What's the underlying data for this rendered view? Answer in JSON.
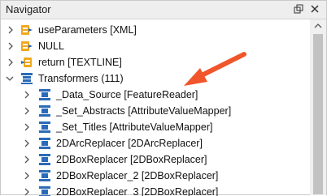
{
  "panel": {
    "title": "Navigator",
    "restore_icon": "restore-icon",
    "close_icon": "close-icon"
  },
  "tree": {
    "items": [
      {
        "label": "useParameters [XML]",
        "expanded": false,
        "icon": "writer-icon"
      },
      {
        "label": "NULL",
        "expanded": false,
        "icon": "writer-icon"
      },
      {
        "label": "return [TEXTLINE]",
        "expanded": false,
        "icon": "writer-return-icon"
      },
      {
        "label": "Transformers (111)",
        "expanded": true,
        "icon": "transformer-group-icon"
      }
    ],
    "children": [
      {
        "label": "_Data_Source [FeatureReader]"
      },
      {
        "label": "_Set_Abstracts [AttributeValueMapper]"
      },
      {
        "label": "_Set_Titles [AttributeValueMapper]"
      },
      {
        "label": "2DArcReplacer [2DArcReplacer]"
      },
      {
        "label": "2DBoxReplacer [2DBoxReplacer]"
      },
      {
        "label": "2DBoxReplacer_2 [2DBoxReplacer]"
      },
      {
        "label": "2DBoxReplacer_3 [2DBoxReplacer]"
      }
    ]
  },
  "colors": {
    "annotation_arrow": "#f0562a",
    "transformer_icon": "#2a6bb8",
    "writer_icon": "#f0a81e"
  }
}
